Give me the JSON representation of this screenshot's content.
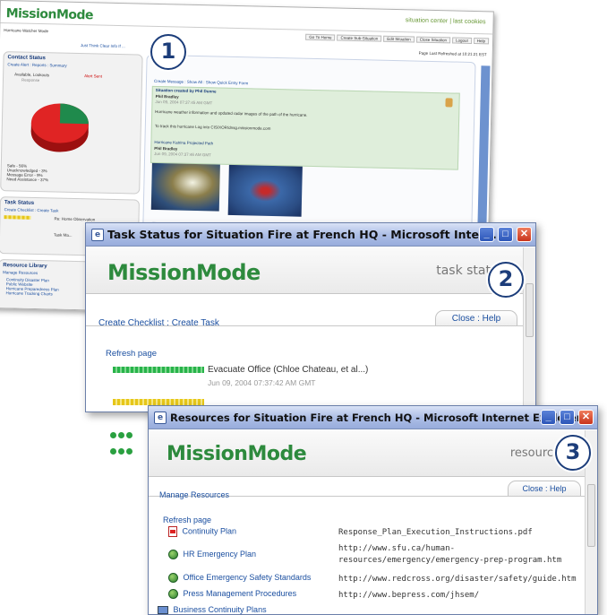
{
  "window1": {
    "logo": "MissionMode",
    "top_links": {
      "center": "situation center",
      "sep": "|",
      "logout": "last cookies"
    },
    "org_line": "Hurricane Watcher Mode",
    "toolbar": [
      "Go To Home",
      "Create Sub-Situation",
      "Edit Situation",
      "Close Situation",
      "Logout",
      "Help"
    ],
    "help_line": "Just Think Clear Info If ...",
    "last_refresh": "Page Last Refreshed at 10:21:21 EST",
    "contact_status": {
      "title": "Contact Status",
      "links": "Create Alert : Reports : Summary",
      "legend_top": [
        "Available, Lookouts",
        "Alert Sent",
        "Response"
      ],
      "legend": [
        "Safe - 56%",
        "Unacknowledged - 3%",
        "Message Error - 9%",
        "Need Assistance - 37%"
      ],
      "colors": {
        "safe": "#1f8a4c",
        "need": "#e02424"
      }
    },
    "task_status": {
      "title": "Task Status",
      "links": "Create Checklist : Create Task",
      "items": [
        "Re: Home Observation",
        "Task Ma..."
      ]
    },
    "resource_library": {
      "title": "Resource Library",
      "links": "Manage Resources",
      "items": [
        "Continuity Disaster Plan",
        "Public Website",
        "Hurricane Preparedness Plan",
        "Hurricane Tracking Charts"
      ]
    },
    "main": {
      "heading": "...",
      "links": "Create Message : Show All : Show Quick Entry Form",
      "posts": [
        {
          "text": "Situation created by Phil Dunne",
          "who": "Phil Bradley",
          "when": "Jun 09, 2004 07:37:45 AM GMT"
        },
        {
          "text": "Hurricane weather information and updated radar images of the path of the hurricane.",
          "who": "",
          "when": ""
        },
        {
          "text": "To track this hurricane Log into CIS/XOR/dnsg.missionmode.com",
          "who": "",
          "when": ""
        },
        {
          "text": "Hurricane Katrina Projected Path",
          "who": "Phil Bradley",
          "when": "Jun 09, 2004 07:37:46 AM GMT"
        }
      ]
    }
  },
  "window2": {
    "title": "Task Status for Situation Fire at French HQ - Microsoft Intern...",
    "logo": "MissionMode",
    "header_text": "task stat",
    "close_help": "Close : Help",
    "create_links": "Create Checklist : Create Task",
    "refresh": "Refresh page",
    "task1": {
      "label": "Evacuate Office (Chloe Chateau, et al...)",
      "date": "Jun 09, 2004 07:37:42 AM GMT",
      "percent_complete": 100
    },
    "task2": {
      "percent_complete": 100
    },
    "badge": "2"
  },
  "window3": {
    "title": "Resources for Situation Fire at French HQ - Microsoft Internet Explorer",
    "logo": "MissionMode",
    "header_text": "resource libr",
    "close_help": "Close : Help",
    "manage": "Manage Resources",
    "refresh": "Refresh page",
    "resources": [
      {
        "name": "Continuity Plan",
        "value": "Response_Plan_Execution_Instructions.pdf",
        "value2": "",
        "icon": "pdf-icon"
      },
      {
        "name": "HR Emergency Plan",
        "value": "http://www.sfu.ca/human-",
        "value2": "resources/emergency/emergency-prep-program.htm",
        "icon": "globe-icon"
      },
      {
        "name": "Office Emergency Safety Standards",
        "value": "http://www.redcross.org/disaster/safety/guide.htm",
        "value2": "",
        "icon": "globe-icon"
      },
      {
        "name": "Press Management Procedures",
        "value": "http://www.bepress.com/jhsem/",
        "value2": "",
        "icon": "globe-icon"
      },
      {
        "name": "Business Continuity Plans",
        "value": "",
        "value2": "",
        "icon": "folder-icon"
      }
    ],
    "badge": "3"
  },
  "badge1": "1"
}
